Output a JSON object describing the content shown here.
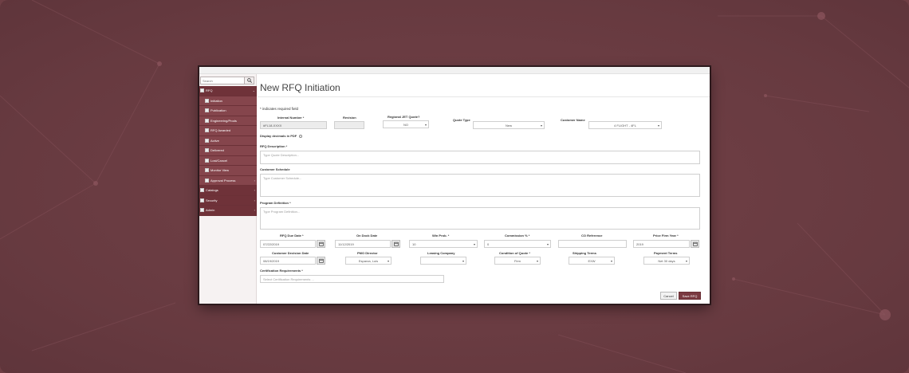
{
  "sidebar": {
    "search_placeholder": "Search",
    "items": [
      {
        "label": "RFQ",
        "level": "top"
      },
      {
        "label": "Initiation",
        "level": "sub"
      },
      {
        "label": "Publication",
        "level": "sub"
      },
      {
        "label": "Engineering/Prods",
        "level": "sub"
      },
      {
        "label": "RFQ Awarded",
        "level": "sub"
      },
      {
        "label": "Active",
        "level": "sub"
      },
      {
        "label": "Delivered",
        "level": "sub"
      },
      {
        "label": "Lost/Cancel",
        "level": "sub"
      },
      {
        "label": "Monitor View",
        "level": "sub"
      },
      {
        "label": "Approval Process",
        "level": "sub"
      },
      {
        "label": "Catalogs",
        "level": "top"
      },
      {
        "label": "Security",
        "level": "top"
      },
      {
        "label": "Admin",
        "level": "top"
      }
    ]
  },
  "page": {
    "title": "New RFQ Initiation",
    "required_note": "* indicates required field"
  },
  "form": {
    "internal_number": {
      "label": "Internal Number *",
      "value": "#FL18-XXXX"
    },
    "revision": {
      "label": "Revision",
      "value": ""
    },
    "regional_jet": {
      "label": "Regional JET Quote?",
      "value": "NO"
    },
    "quote_type": {
      "label": "Quote Type",
      "value": "New"
    },
    "customer_name": {
      "label": "Customer Name",
      "value": "4 FLIGHT - 4FL"
    },
    "display_decimals": {
      "label": "Display decimals in PDF"
    },
    "rfq_description": {
      "label": "RFQ Description *",
      "placeholder": "Type Quote Description..."
    },
    "customer_schedule": {
      "label": "Customer Schedule",
      "placeholder": "Type Customer Schedule..."
    },
    "program_definition": {
      "label": "Program Definition *",
      "placeholder": "Type Program Definition..."
    },
    "rfq_due_date": {
      "label": "RFQ Due Date *",
      "value": "07/22/2019"
    },
    "on_dock_date": {
      "label": "On Dock Date",
      "value": "11/12/2019"
    },
    "win_prob": {
      "label": "Win Prob. *",
      "value": "10"
    },
    "commission": {
      "label": "Commission % *",
      "value": "0"
    },
    "co_reference": {
      "label": "CO Reference",
      "value": ""
    },
    "price_firm_year": {
      "label": "Price Firm Year *",
      "value": "2019"
    },
    "customer_decision_date": {
      "label": "Customer Decision Date",
      "value": "08/19/2019"
    },
    "pmo_director": {
      "label": "PMO Director",
      "value": "Esparza, Luis"
    },
    "leasing_company": {
      "label": "Leasing Company",
      "value": ""
    },
    "condition_of_quote": {
      "label": "Condition of Quote *",
      "value": "Firm"
    },
    "shipping_terms": {
      "label": "Shipping Terms",
      "value": "EXW"
    },
    "payment_terms": {
      "label": "Payment Terms",
      "value": "Net 30 days"
    },
    "certification_requirements": {
      "label": "Certification Requirements *",
      "placeholder": "Select Certification Requirements ..."
    }
  },
  "actions": {
    "cancel": "Cancel",
    "save": "Save RFQ"
  },
  "colors": {
    "brand": "#7a3a41",
    "background": "#6e3e44"
  },
  "icons": {
    "search": "magnifier",
    "calendar": "calendar",
    "dropdown": "chevron-down"
  }
}
